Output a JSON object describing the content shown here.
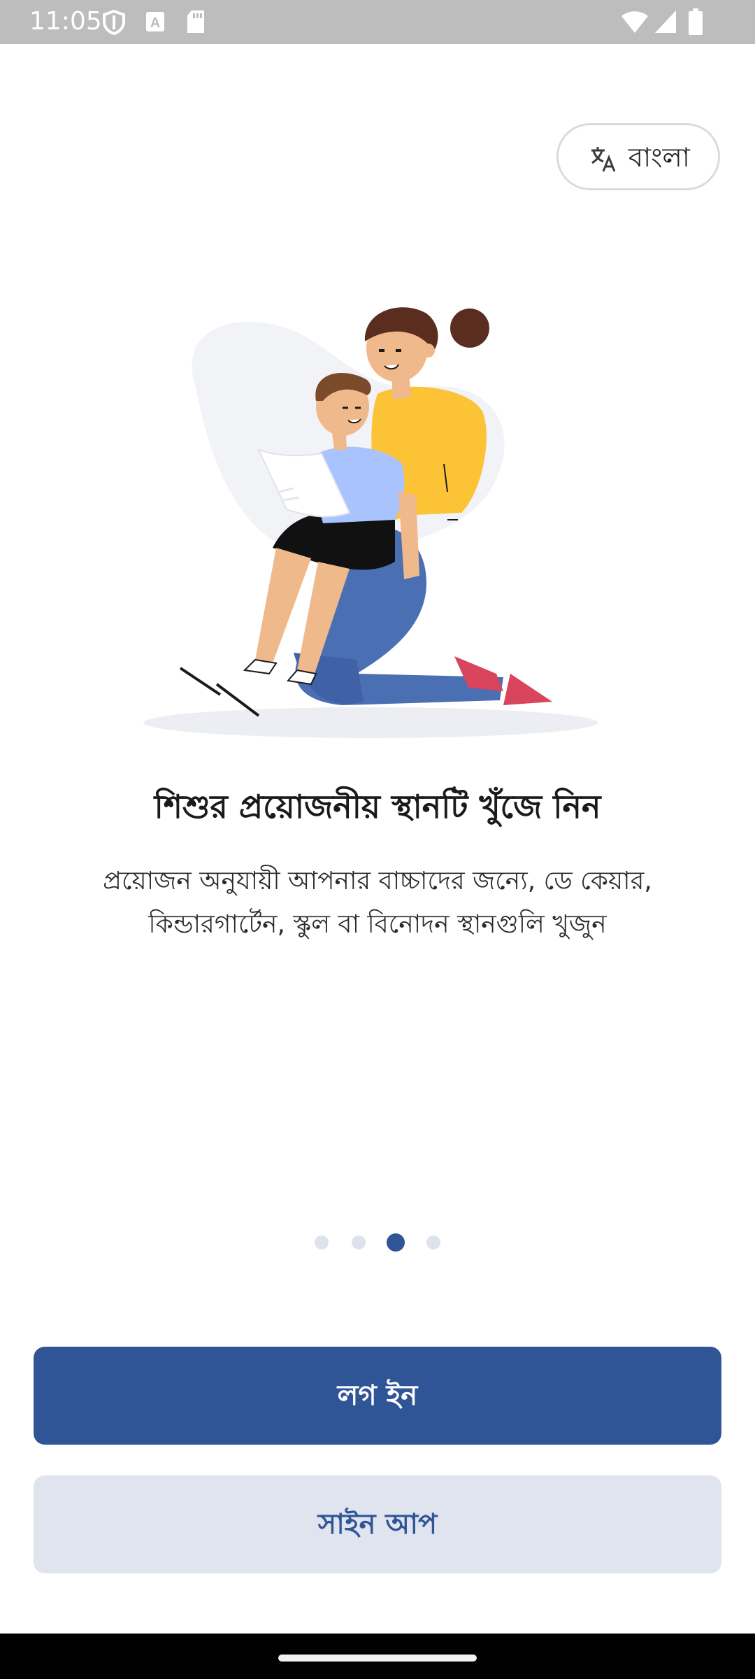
{
  "status_bar": {
    "time": "11:05",
    "left_icons": [
      "shield-icon",
      "a-notification-icon",
      "sd-card-icon"
    ],
    "right_icons": [
      "wifi-icon",
      "cellular-signal-icon",
      "battery-icon"
    ]
  },
  "language_selector": {
    "icon": "translate-icon",
    "label": "বাংলা"
  },
  "onboarding": {
    "illustration": "mother-reading-with-child-illustration",
    "title": "শিশুর প্রয়োজনীয় স্থানটি খুঁজে নিন",
    "description": "প্রয়োজন অনুযায়ী আপনার বাচ্চাদের জন্যে, ডে কেয়ার, কিন্ডারগার্টেন, স্কুল বা বিনোদন স্থানগুলি খুজুন",
    "page_indicator": {
      "total": 4,
      "current": 3
    }
  },
  "actions": {
    "login_label": "লগ ইন",
    "signup_label": "সাইন আপ"
  },
  "colors": {
    "primary": "#2f5597",
    "secondary_button_bg": "#dfe4ee",
    "status_bar": "#bdbdbd",
    "dot_inactive": "#dde2ec"
  }
}
